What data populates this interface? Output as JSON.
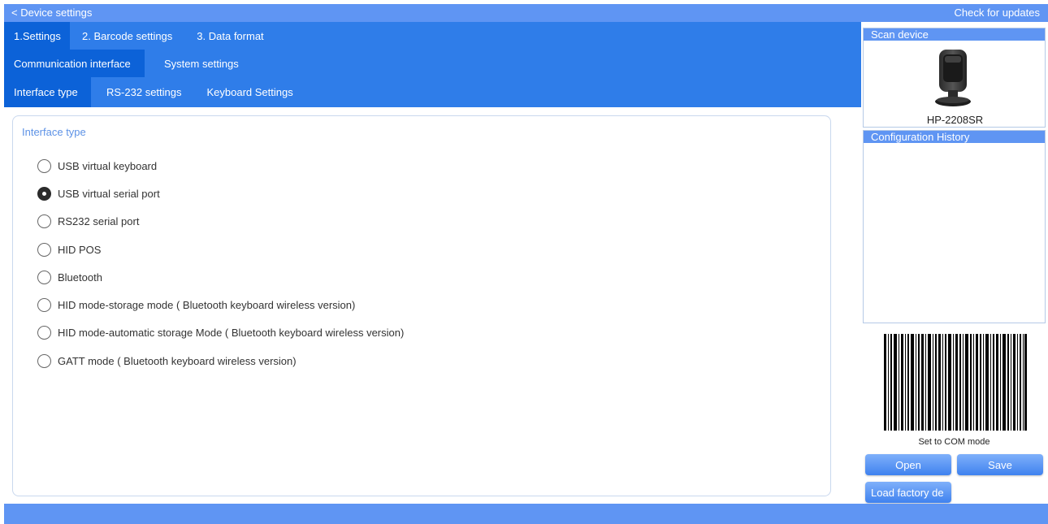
{
  "header": {
    "back_label": "< Device settings",
    "updates_label": "Check for updates"
  },
  "tabs_level1": [
    {
      "label": "1.Settings",
      "active": true
    },
    {
      "label": "2. Barcode settings",
      "active": false
    },
    {
      "label": "3. Data format",
      "active": false
    }
  ],
  "tabs_level2": [
    {
      "label": "Communication interface",
      "active": true
    },
    {
      "label": "System settings",
      "active": false
    }
  ],
  "tabs_level3": [
    {
      "label": "Interface type",
      "active": true
    },
    {
      "label": "RS-232 settings",
      "active": false
    },
    {
      "label": "Keyboard Settings",
      "active": false
    }
  ],
  "interface": {
    "legend": "Interface type",
    "options": [
      {
        "label": "USB virtual keyboard",
        "checked": false
      },
      {
        "label": "USB virtual serial port",
        "checked": true
      },
      {
        "label": "RS232 serial port",
        "checked": false
      },
      {
        "label": "HID POS",
        "checked": false
      },
      {
        "label": "Bluetooth",
        "checked": false
      },
      {
        "label": "HID mode-storage mode ( Bluetooth keyboard wireless version)",
        "checked": false
      },
      {
        "label": "HID mode-automatic storage Mode ( Bluetooth keyboard wireless version)",
        "checked": false
      },
      {
        "label": "GATT mode ( Bluetooth keyboard wireless version)",
        "checked": false
      }
    ]
  },
  "side": {
    "scan_device_title": "Scan device",
    "device_name": "HP-2208SR",
    "history_title": "Configuration History",
    "barcode_caption": "Set to COM mode",
    "open_label": "Open",
    "save_label": "Save",
    "factory_label": "Load factory de"
  },
  "colors": {
    "header_blue": "#5f95f3",
    "tab_blue": "#2f7de9",
    "tab_active": "#0c62d8",
    "legend_blue": "#5d92e6"
  }
}
